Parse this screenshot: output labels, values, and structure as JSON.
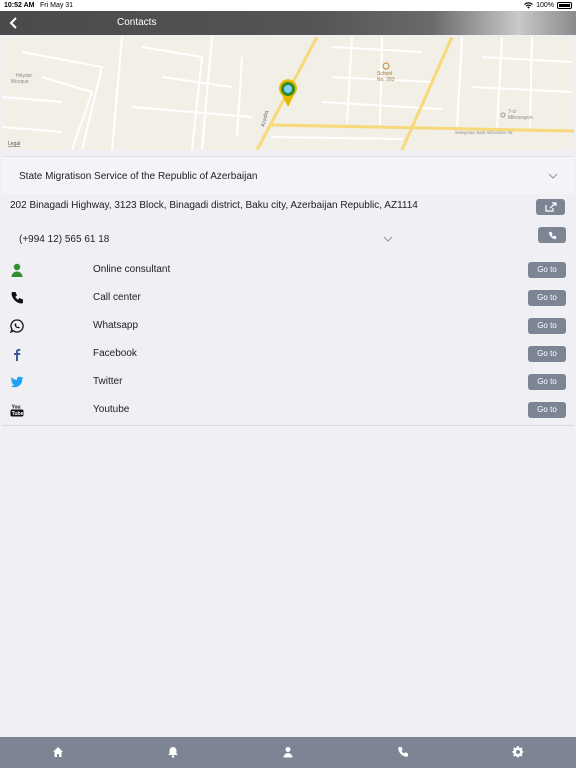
{
  "status_bar": {
    "time": "10:52 AM",
    "date": "Fri May 31",
    "battery": "100%"
  },
  "header": {
    "title": "Contacts"
  },
  "map": {
    "labels": {
      "mosque": "Heydar\nMosque",
      "school": "School\nNo. 283",
      "micro": "7-ci\nMikrorayon",
      "street_akhundov": "Suleyman Sani Akhundov str.",
      "street_azadliq": "Azadliq",
      "legal": "Legal"
    }
  },
  "org": {
    "name": "State Migratison Service of the Republic of Azerbaijan"
  },
  "address": "202 Binagadi Highway, 3123 Block, Binagadi district, Baku city, Azerbaijan Republic, AZ1114",
  "phone": "(+994 12) 565 61 18",
  "contacts": [
    {
      "label": "Online consultant",
      "icon": "user-icon",
      "button": "Go to"
    },
    {
      "label": "Call center",
      "icon": "phone-icon",
      "button": "Go to"
    },
    {
      "label": "Whatsapp",
      "icon": "whatsapp-icon",
      "button": "Go to"
    },
    {
      "label": "Facebook",
      "icon": "facebook-icon",
      "button": "Go to"
    },
    {
      "label": "Twitter",
      "icon": "twitter-icon",
      "button": "Go to"
    },
    {
      "label": "Youtube",
      "icon": "youtube-icon",
      "button": "Go to"
    }
  ],
  "tabbar": {
    "items": [
      "home-icon",
      "bell-icon",
      "profile-icon",
      "phone-icon",
      "gear-icon"
    ]
  },
  "colors": {
    "button": "#7d8595",
    "accent_green": "#2f8f2f",
    "twitter": "#1da1f2",
    "facebook": "#3b5998"
  }
}
